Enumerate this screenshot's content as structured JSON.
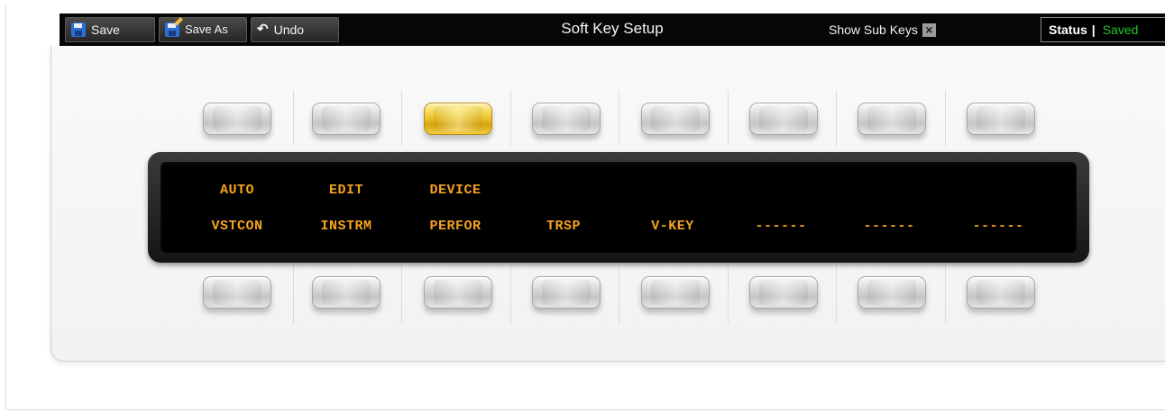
{
  "toolbar": {
    "save_label": "Save",
    "save_as_label": "Save As",
    "undo_label": "Undo",
    "title": "Soft Key Setup",
    "show_sub_keys_label": "Show Sub Keys",
    "show_sub_keys_checked": true,
    "show_sub_keys_mark": "×",
    "status_label": "Status",
    "status_separator": "|",
    "status_value": "Saved",
    "status_color": "#22c522"
  },
  "soft_keys": {
    "active_top_key_index": 2,
    "active_color": "#f0cc3c",
    "top_row": [
      "AUTO",
      "EDIT",
      "DEVICE",
      "",
      "",
      "",
      "",
      ""
    ],
    "bottom_row": [
      "VSTCON",
      "INSTRM",
      "PERFOR",
      "TRSP",
      "V-KEY",
      "------",
      "------",
      "------"
    ],
    "text_color": "#f4a21f"
  },
  "icons": {
    "save": "floppy-disk-icon",
    "save_as": "floppy-disk-pencil-icon",
    "undo": "undo-arrow-icon",
    "show_sub_keys": "checkbox-x-icon"
  }
}
